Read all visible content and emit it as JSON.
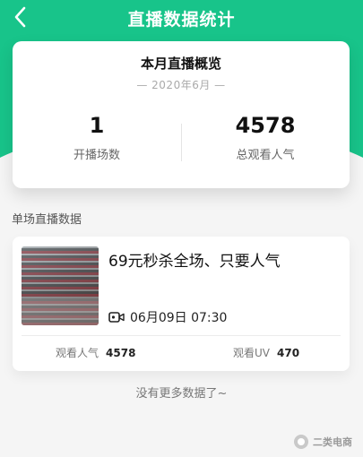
{
  "header": {
    "title": "直播数据统计",
    "back_icon": "chevron-left-icon",
    "bg_color": "#18c48a"
  },
  "summary": {
    "title": "本月直播概览",
    "period": "— 2020年6月 —",
    "stats": [
      {
        "value": "1",
        "label": "开播场数"
      },
      {
        "value": "4578",
        "label": "总观看人气"
      }
    ]
  },
  "single_section": {
    "title": "单场直播数据",
    "items": [
      {
        "title": "69元秒杀全场、只要人气",
        "time_icon": "video-camera-icon",
        "time": "06月09日 07:30",
        "metrics": [
          {
            "label": "观看人气",
            "value": "4578"
          },
          {
            "label": "观看UV",
            "value": "470"
          }
        ]
      }
    ]
  },
  "footer": {
    "no_more_text": "没有更多数据了~"
  },
  "watermark": {
    "text": "二类电商"
  }
}
